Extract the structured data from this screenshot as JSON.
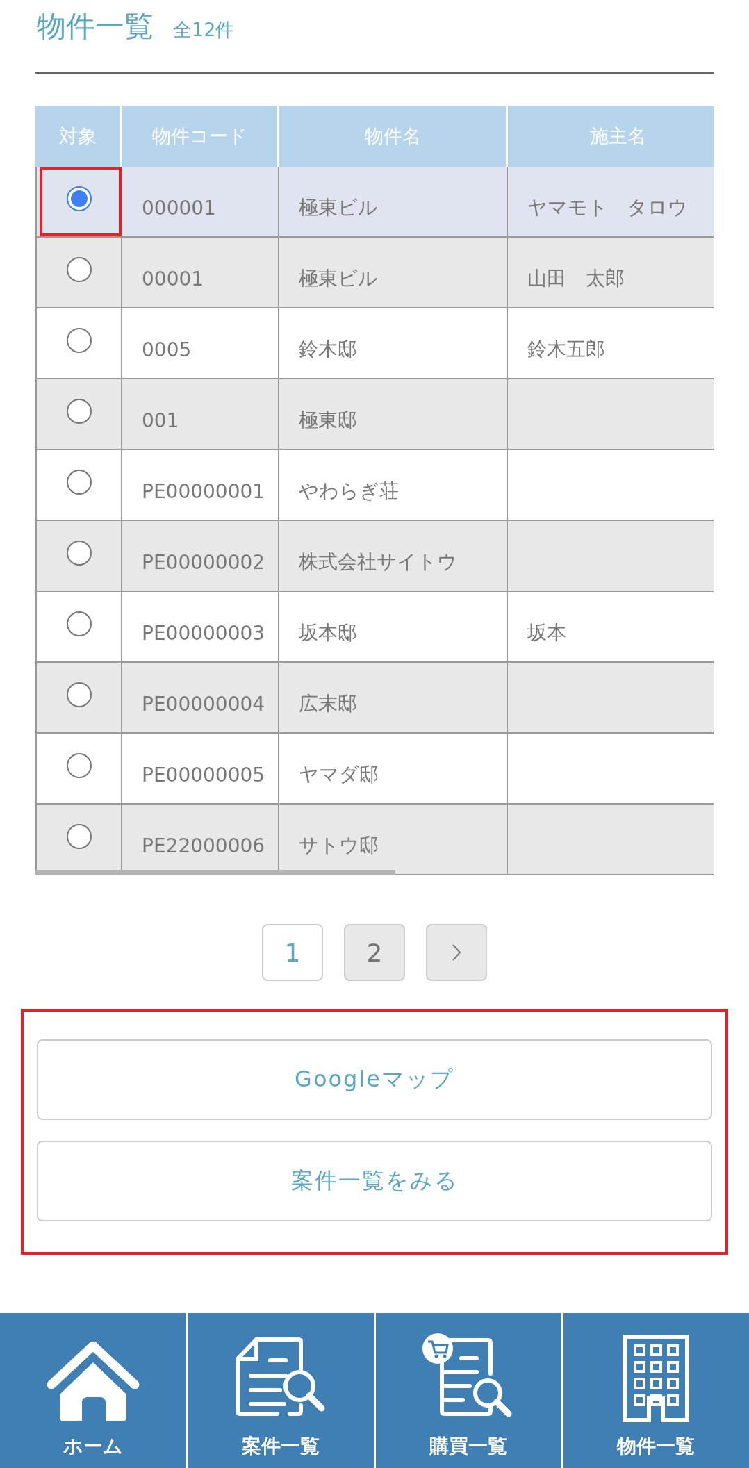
{
  "header": {
    "title": "物件一覧",
    "count": "全12件"
  },
  "table": {
    "columns": [
      "対象",
      "物件コード",
      "物件名",
      "施主名"
    ],
    "rows": [
      {
        "selected": true,
        "highlighted": true,
        "cells": [
          "",
          "000001",
          "極東ビル",
          "ヤマモト　タロウ"
        ]
      },
      {
        "selected": false,
        "highlighted": false,
        "cells": [
          "",
          "00001",
          "極東ビル",
          "山田　太郎"
        ]
      },
      {
        "selected": false,
        "highlighted": false,
        "cells": [
          "",
          "0005",
          "鈴木邸",
          "鈴木五郎"
        ]
      },
      {
        "selected": false,
        "highlighted": false,
        "cells": [
          "",
          "001",
          "極東邸",
          ""
        ]
      },
      {
        "selected": false,
        "highlighted": false,
        "cells": [
          "",
          "PE00000001",
          "やわらぎ荘",
          ""
        ]
      },
      {
        "selected": false,
        "highlighted": false,
        "cells": [
          "",
          "PE00000002",
          "株式会社サイトウ",
          ""
        ]
      },
      {
        "selected": false,
        "highlighted": false,
        "cells": [
          "",
          "PE00000003",
          "坂本邸",
          "坂本"
        ]
      },
      {
        "selected": false,
        "highlighted": false,
        "cells": [
          "",
          "PE00000004",
          "広末邸",
          ""
        ]
      },
      {
        "selected": false,
        "highlighted": false,
        "cells": [
          "",
          "PE00000005",
          "ヤマダ邸",
          ""
        ]
      },
      {
        "selected": false,
        "highlighted": false,
        "cells": [
          "",
          "PE22000006",
          "サトウ邸",
          ""
        ]
      }
    ]
  },
  "pagination": {
    "pages": [
      {
        "label": "1",
        "selected": true
      },
      {
        "label": "2",
        "selected": false
      }
    ]
  },
  "actions": {
    "highlighted": true,
    "buttons": [
      "Googleマップ",
      "案件一覧をみる"
    ]
  },
  "bottom_nav": [
    {
      "label": "ホーム",
      "kind": "home"
    },
    {
      "label": "案件一覧",
      "kind": "document-search"
    },
    {
      "label": "購買一覧",
      "kind": "cart-document-search"
    },
    {
      "label": "物件一覧",
      "kind": "building"
    }
  ]
}
